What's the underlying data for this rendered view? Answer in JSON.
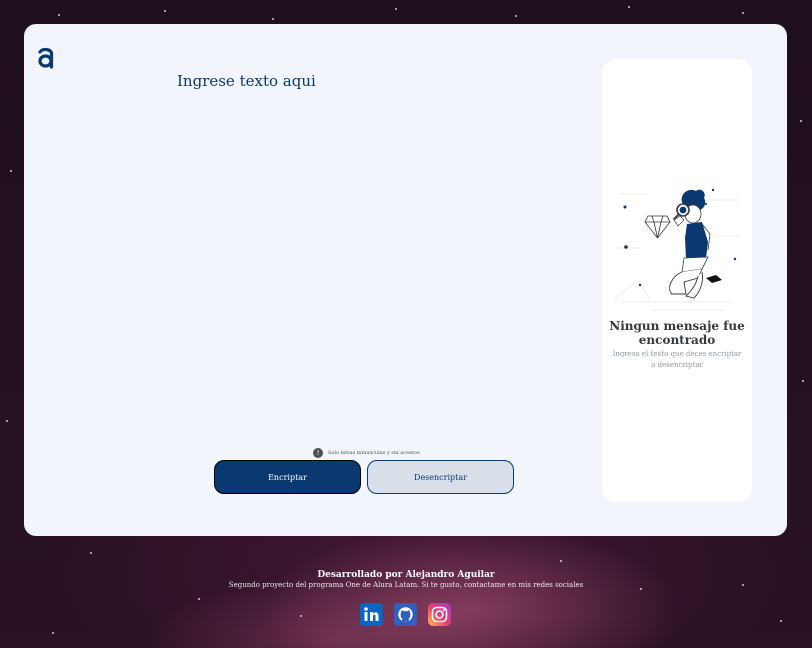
{
  "editor": {
    "placeholder": "Ingrese texto aqui"
  },
  "hint": {
    "icon_glyph": "!",
    "text": "Solo letras minusculas y sin acentos"
  },
  "buttons": {
    "encrypt_label": "Encriptar",
    "decrypt_label": "Desencriptar"
  },
  "result": {
    "empty_title": "Ningun mensaje fue encontrado",
    "empty_description": "Ingresa el texto que deces encriptar o desencriptar"
  },
  "footer": {
    "title": "Desarrollado por Alejandro Aguilar",
    "subtitle": "Segundo proyecto del programa One de Alura Latam. Si te gusto, contactame en mis redes sociales",
    "socials": [
      {
        "name": "linkedin-icon",
        "color": "#0a66c2"
      },
      {
        "name": "github-icon",
        "color": "#2f5fbf"
      },
      {
        "name": "instagram-icon",
        "color": "#d6249f"
      }
    ]
  },
  "colors": {
    "primary": "#0a3871",
    "card_background": "#f2f5fc",
    "secondary_button": "#d8dfe8",
    "hint_text": "#495057"
  }
}
